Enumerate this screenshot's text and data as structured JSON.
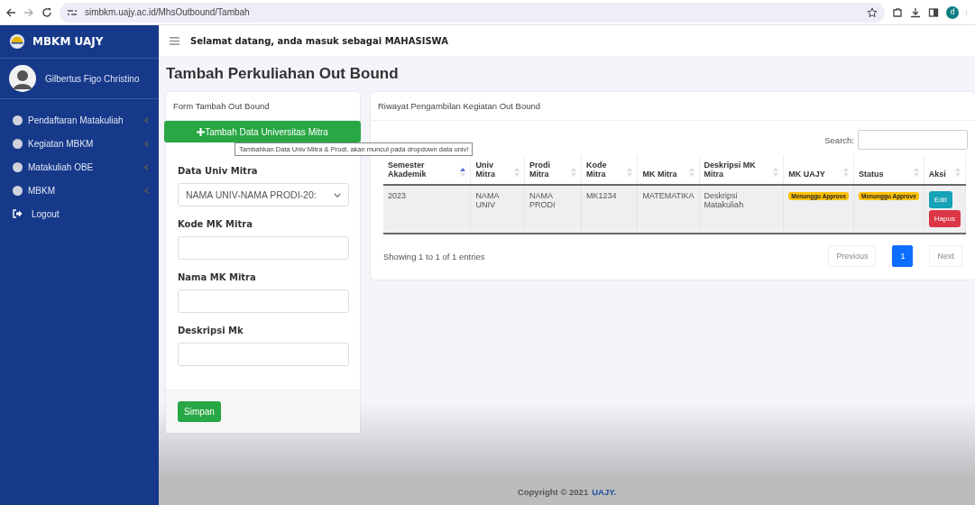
{
  "browser": {
    "url": "simbkm.uajy.ac.id/MhsOutbound/Tambah",
    "profile": "d"
  },
  "sidebar": {
    "brand": "MBKM UAJY",
    "user": "Gilbertus Figo Christino",
    "items": [
      {
        "label": "Pendaftaran Matakuliah",
        "kind": "menu"
      },
      {
        "label": "Kegiatan MBKM",
        "kind": "menu"
      },
      {
        "label": "Matakuliah OBE",
        "kind": "menu"
      },
      {
        "label": "MBKM",
        "kind": "menu"
      },
      {
        "label": "Logout",
        "kind": "logout"
      }
    ]
  },
  "topbar": {
    "welcome": "Selamat datang, anda masuk sebagai MAHASISWA"
  },
  "page_title": "Tambah Perkuliahan Out Bound",
  "form": {
    "title": "Form Tambah Out Bound",
    "add_button": "Tambah Data Universitas Mitra",
    "tooltip": "Tambahkan Data Univ Mitra & Prodi, akan muncul pada dropdown data univ!",
    "fields": [
      {
        "label": "Data Univ Mitra",
        "kind": "select",
        "value": "NAMA UNIV-NAMA PRODI-20:"
      },
      {
        "label": "Kode MK Mitra",
        "kind": "text"
      },
      {
        "label": "Nama MK Mitra",
        "kind": "text"
      },
      {
        "label": "Deskripsi Mk",
        "kind": "text"
      }
    ],
    "submit": "Simpan"
  },
  "history": {
    "title": "Riwayat Pengambilan Kegiatan Out Bound",
    "search_label": "Search:",
    "columns": [
      {
        "label": "Semester Akademik",
        "sorted": true
      },
      {
        "label": "Univ Mitra",
        "sorted": false
      },
      {
        "label": "Prodi Mitra",
        "sorted": false
      },
      {
        "label": "Kode Mitra",
        "sorted": false
      },
      {
        "label": "MK Mitra",
        "sorted": false
      },
      {
        "label": "Deskripsi MK Mitra",
        "sorted": false
      },
      {
        "label": "MK UAJY",
        "sorted": false
      },
      {
        "label": "Status",
        "sorted": false
      },
      {
        "label": "Aksi",
        "sorted": false
      }
    ],
    "rows": [
      {
        "semester": "2023",
        "univ": "NAMA UNIV",
        "prodi": "NAMA PRODI",
        "kode": "MK1234",
        "mk": "MATEMATIKA",
        "deskripsi": "Deskripsi Matakuliah",
        "mk_uajy": "Menunggu Approve",
        "status": "Menunggu Approve",
        "actions": [
          "Edit",
          "Hapus"
        ]
      }
    ],
    "info": "Showing 1 to 1 of 1 entries",
    "pagination": [
      {
        "label": "Previous",
        "selected": false
      },
      {
        "label": "1",
        "selected": true
      },
      {
        "label": "Next",
        "selected": false
      }
    ]
  },
  "footer": {
    "text": "Copyright © 2021",
    "link": "UAJY."
  }
}
